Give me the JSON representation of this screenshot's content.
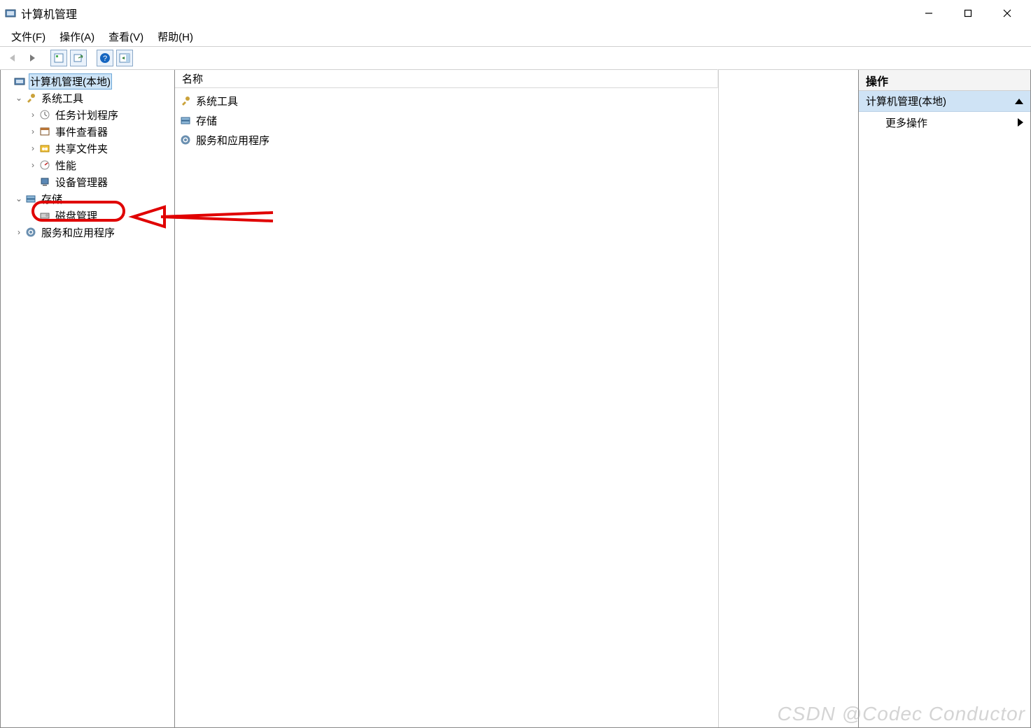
{
  "window": {
    "title": "计算机管理"
  },
  "menu": {
    "file": "文件(F)",
    "action": "操作(A)",
    "view": "查看(V)",
    "help": "帮助(H)"
  },
  "toolbar_icons": {
    "back": "back-arrow-icon",
    "forward": "forward-arrow-icon",
    "properties": "properties-icon",
    "export": "export-icon",
    "help": "help-icon",
    "pane": "show-pane-icon"
  },
  "tree": {
    "root": "计算机管理(本地)",
    "system_tools": "系统工具",
    "task_scheduler": "任务计划程序",
    "event_viewer": "事件查看器",
    "shared_folders": "共享文件夹",
    "performance": "性能",
    "device_manager": "设备管理器",
    "storage": "存储",
    "disk_mgmt": "磁盘管理",
    "services_apps": "服务和应用程序"
  },
  "list": {
    "header_name": "名称",
    "items": [
      {
        "label": "系统工具",
        "icon": "tools-icon"
      },
      {
        "label": "存储",
        "icon": "storage-icon"
      },
      {
        "label": "服务和应用程序",
        "icon": "services-icon"
      }
    ]
  },
  "actions": {
    "header": "操作",
    "section": "计算机管理(本地)",
    "more": "更多操作"
  },
  "watermark": "CSDN @Codec Conductor"
}
